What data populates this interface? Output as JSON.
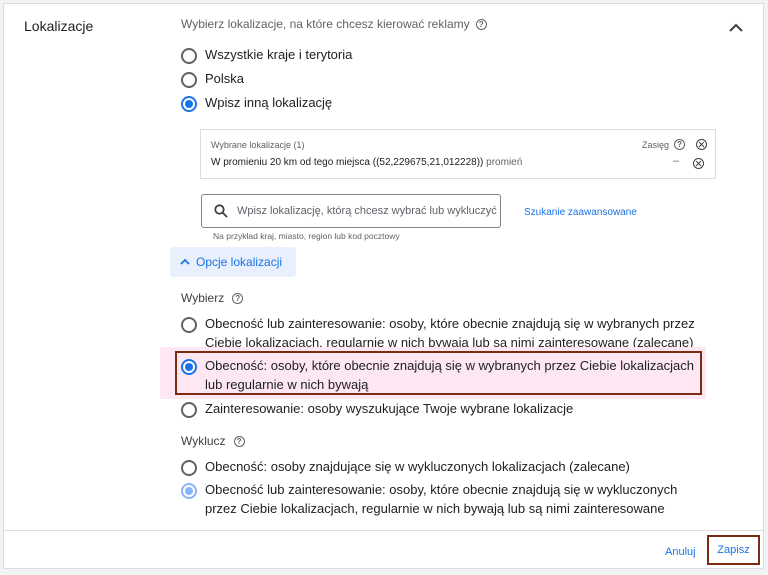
{
  "section": {
    "title": "Lokalizacje"
  },
  "targeting": {
    "subtitle": "Wybierz lokalizacje, na które chcesz kierować reklamy",
    "options": [
      {
        "label": "Wszystkie kraje i terytoria",
        "checked": false
      },
      {
        "label": "Polska",
        "checked": false
      },
      {
        "label": "Wpisz inną lokalizację",
        "checked": true
      }
    ]
  },
  "selected_locations": {
    "header": "Wybrane lokalizacje (1)",
    "reach_label": "Zasięg",
    "item_text": "W promieniu 20 km od tego miejsca ((52,229675,21,012228))",
    "item_suffix": "promień",
    "item_reach": "–"
  },
  "search": {
    "placeholder": "Wpisz lokalizację, którą chcesz wybrać lub wykluczyć",
    "advanced_link": "Szukanie zaawansowane",
    "hint": "Na przykład kraj, miasto, region lub kod pocztowy"
  },
  "location_options": {
    "toggle_label": "Opcje lokalizacji"
  },
  "include": {
    "label": "Wybierz",
    "options": [
      {
        "label": "Obecność lub zainteresowanie: osoby, które obecnie znajdują się w wybranych przez Ciebie lokalizacjach, regularnie w nich bywają lub są nimi zainteresowane (zalecane)",
        "checked": false
      },
      {
        "label": "Obecność: osoby, które obecnie znajdują się w wybranych przez Ciebie lokalizacjach lub regularnie w nich bywają",
        "checked": true
      },
      {
        "label": "Zainteresowanie: osoby wyszukujące Twoje wybrane lokalizacje",
        "checked": false
      }
    ]
  },
  "exclude": {
    "label": "Wyklucz",
    "options": [
      {
        "label": "Obecność: osoby znajdujące się w wykluczonych lokalizacjach (zalecane)",
        "checked": false
      },
      {
        "label": "Obecność lub zainteresowanie: osoby, które obecnie znajdują się w wykluczonych przez Ciebie lokalizacjach, regularnie w nich bywają lub są nimi zainteresowane",
        "checked": true
      }
    ]
  },
  "footer": {
    "cancel_label": "Anuluj",
    "save_label": "Zapisz"
  },
  "colors": {
    "accent": "#1a73e8",
    "highlight_frame": "#7b2b11",
    "highlight_bg": "#fde7f3"
  }
}
